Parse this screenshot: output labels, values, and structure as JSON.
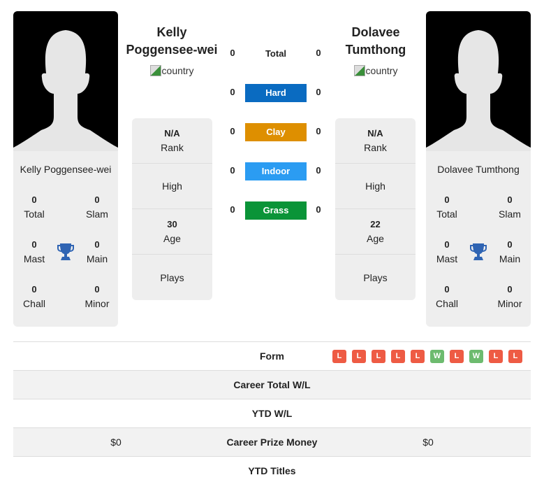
{
  "players": [
    {
      "name": "Kelly Poggensee-wei",
      "name_line1": "Kelly",
      "name_line2": "Poggensee-wei",
      "country_alt": "country",
      "titles": {
        "total": "0",
        "slam": "0",
        "mast": "0",
        "main": "0",
        "chall": "0",
        "minor": "0"
      },
      "rank": "N/A",
      "high": "",
      "age": "30",
      "plays": ""
    },
    {
      "name": "Dolavee Tumthong",
      "name_line1": "Dolavee",
      "name_line2": "Tumthong",
      "country_alt": "country",
      "titles": {
        "total": "0",
        "slam": "0",
        "mast": "0",
        "main": "0",
        "chall": "0",
        "minor": "0"
      },
      "rank": "N/A",
      "high": "",
      "age": "22",
      "plays": ""
    }
  ],
  "labels": {
    "total": "Total",
    "slam": "Slam",
    "mast": "Mast",
    "main": "Main",
    "chall": "Chall",
    "minor": "Minor",
    "rank": "Rank",
    "high": "High",
    "age": "Age",
    "plays": "Plays"
  },
  "surfaces": [
    {
      "label": "Total",
      "left": "0",
      "right": "0",
      "color": ""
    },
    {
      "label": "Hard",
      "left": "0",
      "right": "0",
      "color": "#0a6bc1"
    },
    {
      "label": "Clay",
      "left": "0",
      "right": "0",
      "color": "#de8f00"
    },
    {
      "label": "Indoor",
      "left": "0",
      "right": "0",
      "color": "#2b9cf2"
    },
    {
      "label": "Grass",
      "left": "0",
      "right": "0",
      "color": "#0a9438"
    }
  ],
  "form": {
    "label": "Form",
    "results": [
      "L",
      "L",
      "L",
      "L",
      "L",
      "W",
      "L",
      "W",
      "L",
      "L"
    ],
    "colors": {
      "L": "#ee5b44",
      "W": "#6dbb6f"
    }
  },
  "rows": [
    {
      "label": "Career Total W/L",
      "left": "",
      "right": ""
    },
    {
      "label": "YTD W/L",
      "left": "",
      "right": ""
    },
    {
      "label": "Career Prize Money",
      "left": "$0",
      "right": "$0"
    },
    {
      "label": "YTD Titles",
      "left": "",
      "right": ""
    }
  ],
  "colors": {
    "trophy": "#2f64b3",
    "card_bg": "#eeeeee"
  }
}
